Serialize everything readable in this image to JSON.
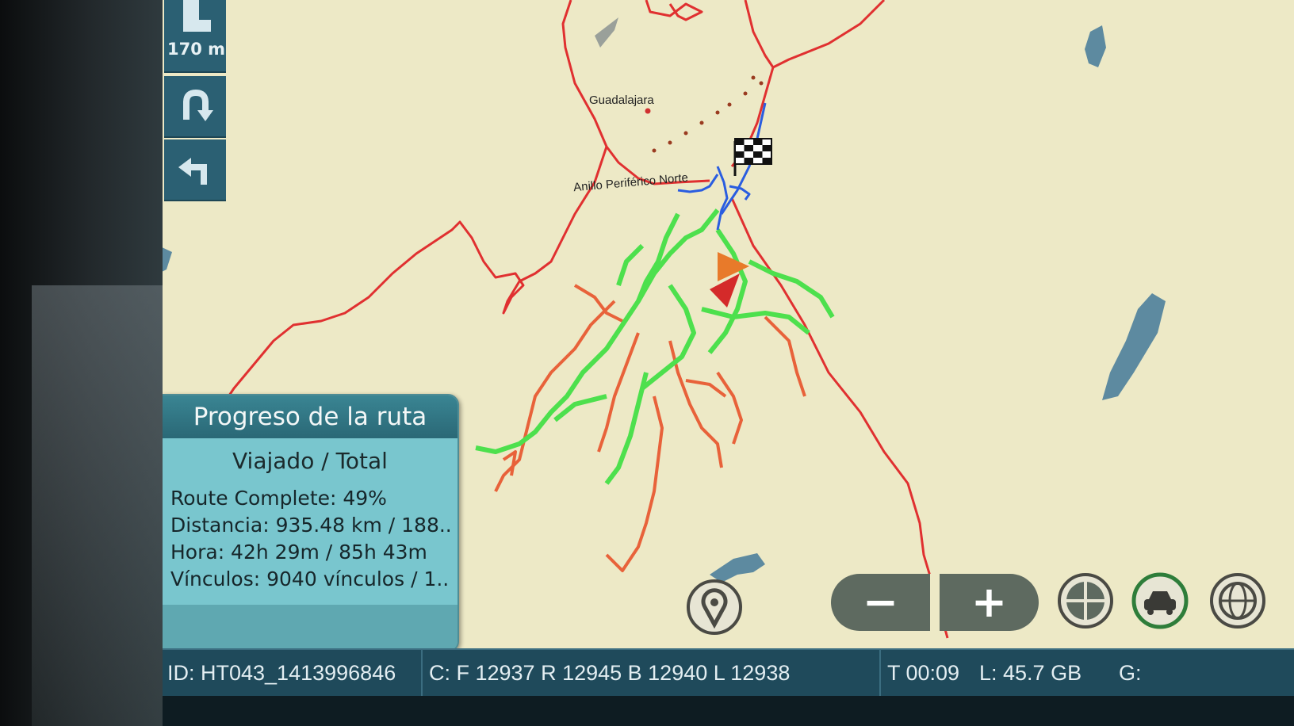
{
  "maneuvers": {
    "distance": "170 m",
    "items": [
      {
        "icon": "turn-left-arrow-icon"
      },
      {
        "icon": "u-turn-icon"
      },
      {
        "icon": "turn-left-icon"
      }
    ]
  },
  "map": {
    "labels": {
      "city": "Guadalajara",
      "road": "Anillo Periférico Norte"
    },
    "colors": {
      "background": "#ede9c6",
      "road": "#e03030",
      "traveled": "#4de04d",
      "remaining": "#e8623a",
      "current_leg": "#2a5de0",
      "water": "#5d8aa0"
    }
  },
  "progress_panel": {
    "title": "Progreso de la ruta",
    "subtitle": "Viajado / Total",
    "lines": [
      "Route Complete: 49%",
      "Distancia: 935.48 km / 188...",
      "Hora: 42h 29m / 85h 43m",
      "Vínculos: 9040 vínculos / 1..."
    ]
  },
  "controls": {
    "zoom_out": "−",
    "zoom_in": "+",
    "icons": [
      "location-pin-icon",
      "crosshair-icon",
      "car-follow-icon",
      "globe-icon"
    ]
  },
  "status_bar": {
    "id": "ID: HT043_1413996846",
    "cameras": "C: F 12937 R 12945 B 12940 L 12938",
    "time": "T 00:09",
    "storage": "L:  45.7 GB",
    "gps": "G:"
  }
}
